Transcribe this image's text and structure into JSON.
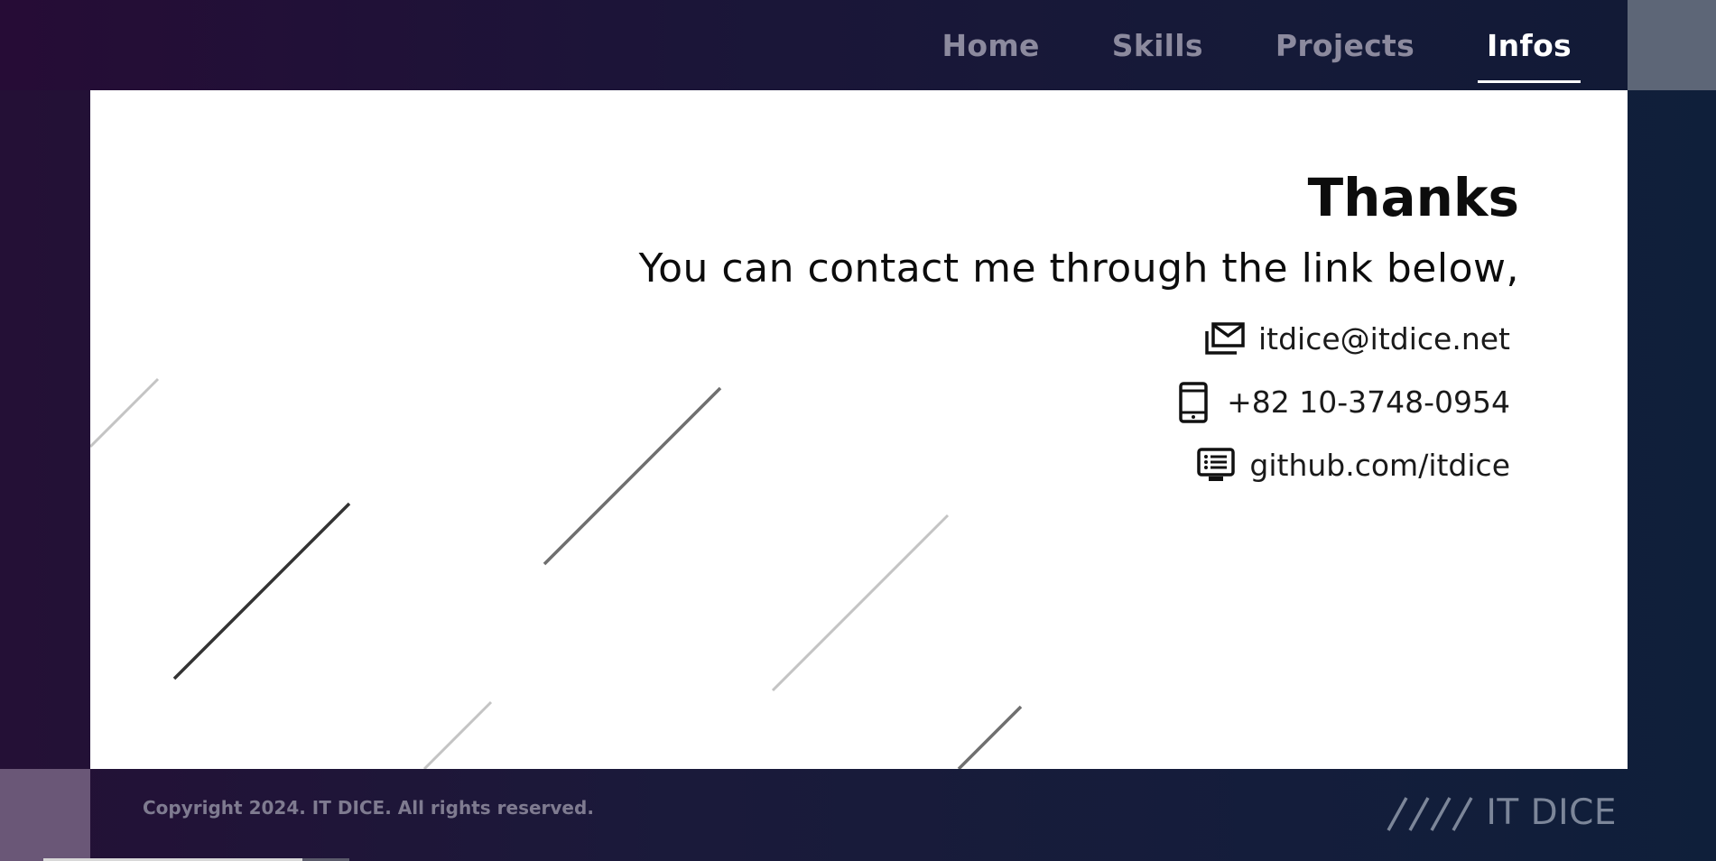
{
  "nav": {
    "items": [
      {
        "label": "Home"
      },
      {
        "label": "Skills"
      },
      {
        "label": "Projects"
      },
      {
        "label": "Infos"
      }
    ],
    "active": "Infos"
  },
  "main": {
    "title": "Thanks",
    "subtitle": "You can contact me through the link below,",
    "contacts": [
      {
        "icon": "email-icon",
        "text": "itdice@itdice.net"
      },
      {
        "icon": "phone-icon",
        "text": "+82 10-3748-0954"
      },
      {
        "icon": "github-icon",
        "text": "github.com/itdice"
      }
    ]
  },
  "footer": {
    "copyright": "Copyright 2024. IT DICE. All rights reserved.",
    "logo_text": "IT DICE"
  },
  "colors": {
    "nav_inactive": "#8c8a9e",
    "nav_active": "#ffffff",
    "card_bg": "#ffffff",
    "footer_text": "#7f7b90",
    "logo": "#7c8699"
  }
}
